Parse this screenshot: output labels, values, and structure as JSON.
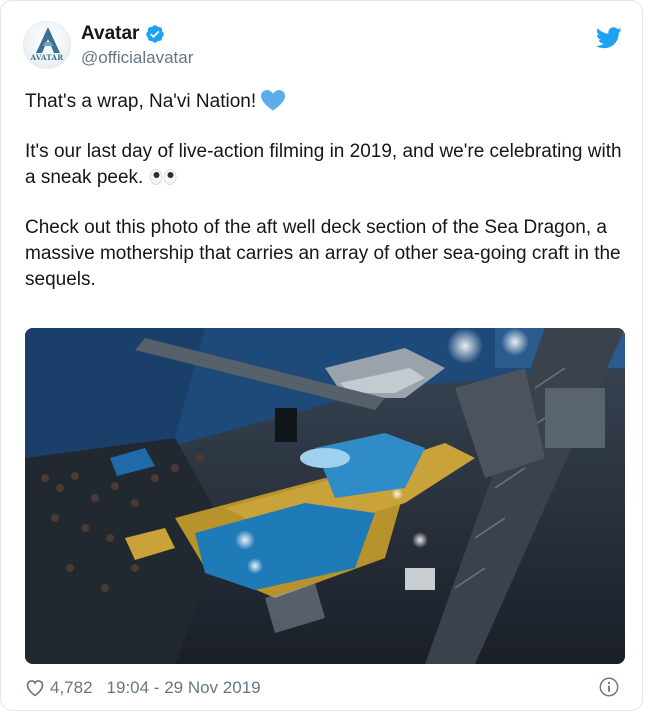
{
  "account": {
    "display_name": "Avatar",
    "handle": "@officialavatar",
    "verified": true,
    "avatar_logo_text": "AVATAR"
  },
  "tweet": {
    "paragraphs": [
      "That's a wrap, Na'vi Nation!",
      "It's our last day of live-action filming in 2019, and we're celebrating with a sneak peek.",
      "Check out this photo of the aft well deck section of the Sea Dragon, a massive mothership that carries an array of other sea-going craft in the sequels."
    ],
    "emojis": [
      "blue-heart",
      "eyes"
    ]
  },
  "media": {
    "type": "photo",
    "subject": "film stage set with water tank and yellow platforms"
  },
  "footer": {
    "like_count": "4,782",
    "timestamp": "19:04 - 29 Nov 2019"
  },
  "colors": {
    "brand_blue": "#1da1f2",
    "heart_blue": "#5dadec",
    "secondary_text": "#657786",
    "primary_text": "#14171a"
  },
  "icons": [
    "twitter-bird-icon",
    "verified-badge-icon",
    "heart-outline-icon",
    "info-icon"
  ]
}
